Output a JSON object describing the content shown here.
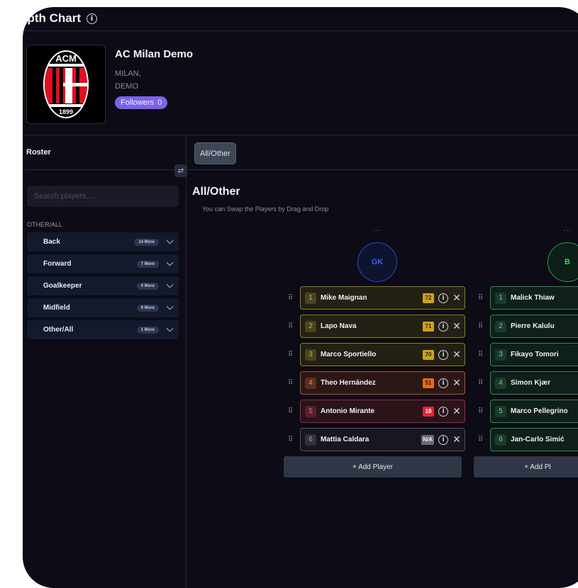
{
  "header": {
    "title": "epth Chart",
    "info_icon": "info-icon"
  },
  "team": {
    "name": "AC Milan Demo",
    "city": "MILAN,",
    "country": "DEMO",
    "followers_label": "Followers",
    "followers_count": "0",
    "logo_text_top": "ACM",
    "logo_text_bottom": "1899",
    "logo_colors": {
      "red": "#e10f1f",
      "black": "#000000",
      "white": "#ffffff"
    }
  },
  "sidebar": {
    "title": "Roster",
    "search_placeholder": "Search players...",
    "group_label": "OTHER/ALL",
    "positions": [
      {
        "name": "Back",
        "more": "14 More"
      },
      {
        "name": "Forward",
        "more": "7 More"
      },
      {
        "name": "Goalkeeper",
        "more": "4 More"
      },
      {
        "name": "Midfield",
        "more": "9 More"
      },
      {
        "name": "Other/All",
        "more": "1 More"
      }
    ]
  },
  "tabs": [
    {
      "label": "All/Other",
      "active": true
    }
  ],
  "section": {
    "title": "All/Other",
    "subtitle": "You can Swap the Players by Drag and Drop"
  },
  "columns": [
    {
      "badge": "GK",
      "dots": "...",
      "add_label": "+ Add Player",
      "players": [
        {
          "num": "1",
          "name": "Mike Maignan",
          "score": "72",
          "tone": "yellow"
        },
        {
          "num": "2",
          "name": "Lapo Nava",
          "score": "71",
          "tone": "yellow"
        },
        {
          "num": "3",
          "name": "Marco Sportiello",
          "score": "70",
          "tone": "yellow"
        },
        {
          "num": "4",
          "name": "Theo Hernández",
          "score": "51",
          "tone": "orange"
        },
        {
          "num": "5",
          "name": "Antonio Mirante",
          "score": "18",
          "tone": "red"
        },
        {
          "num": "6",
          "name": "Mattia Caldara",
          "score": "N/A",
          "tone": "gray"
        }
      ]
    },
    {
      "badge": "B",
      "dots": "...",
      "add_label": "+ Add Pl",
      "players": [
        {
          "num": "1",
          "name": "Malick Thiaw"
        },
        {
          "num": "2",
          "name": "Pierre Kalulu"
        },
        {
          "num": "3",
          "name": "Fikayo Tomori"
        },
        {
          "num": "4",
          "name": "Simon Kjær"
        },
        {
          "num": "5",
          "name": "Marco Pellegrino"
        },
        {
          "num": "6",
          "name": "Jan-Carlo Simić"
        }
      ]
    }
  ]
}
